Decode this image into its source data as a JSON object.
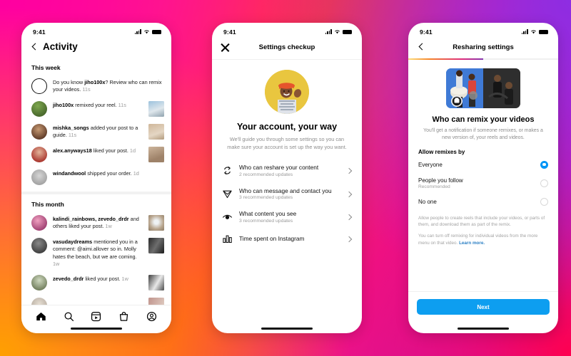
{
  "background": {
    "colors": [
      "#ff0f9c",
      "#ff3d2e",
      "#ffa000",
      "#8e2de2",
      "#ff0050"
    ]
  },
  "phone1": {
    "name": "activity-screen",
    "status": {
      "time": "9:41",
      "signal_icon": "signal-bars-icon",
      "wifi_icon": "wifi-icon",
      "battery_icon": "battery-icon"
    },
    "header": {
      "back_icon": "chevron-left-icon",
      "title": "Activity"
    },
    "sections": [
      {
        "label": "This week",
        "items": [
          {
            "avatar": "ring-icon",
            "avatar_style": "ring",
            "text_pre": "Do you know ",
            "bold": "jiho100x",
            "text_post": "? Review who can remix your videos. ",
            "time": "11s",
            "thumb": false
          },
          {
            "avatar": "avatar-jiho100x",
            "avatar_style": "photo-green",
            "text_pre": "",
            "bold": "jiho100x",
            "text_post": " remixed your reel. ",
            "time": "11s",
            "thumb": true,
            "thumb_style": "t1"
          },
          {
            "avatar": "avatar-mishka-songs",
            "avatar_style": "photo-brown",
            "text_pre": "",
            "bold": "mishka_songs",
            "text_post": " added your post to a guide. ",
            "time": "11s",
            "thumb": true,
            "thumb_style": "t2"
          },
          {
            "avatar": "avatar-alex-anyways18",
            "avatar_style": "photo-red",
            "text_pre": "",
            "bold": "alex.anyways18",
            "text_post": " liked your post. ",
            "time": "1d",
            "thumb": true,
            "thumb_style": "t3"
          },
          {
            "avatar": "avatar-windandwool",
            "avatar_style": "photo-grey",
            "text_pre": "",
            "bold": "windandwool",
            "text_post": " shipped your order. ",
            "time": "1d",
            "thumb": false
          }
        ]
      },
      {
        "label": "This month",
        "items": [
          {
            "avatar": "avatar-kalindi-rainbows",
            "avatar_style": "photo-pink",
            "text_pre": "",
            "bold": "kalindi_rainbows, zevedo_drdr",
            "text_post": " and others liked your post. ",
            "time": "1w",
            "thumb": true,
            "thumb_style": "t4"
          },
          {
            "avatar": "avatar-vasudaydreams",
            "avatar_style": "photo-dark",
            "text_pre": "",
            "bold": "vasudaydreams",
            "text_post": " mentioned you in a comment: @aimi.allover so in. Molly hates the beach, but we are coming. ",
            "time": "1w",
            "thumb": true,
            "thumb_style": "t5"
          },
          {
            "avatar": "avatar-zevedo-drdr",
            "avatar_style": "photo-green2",
            "text_pre": "",
            "bold": "zevedo_drdr",
            "text_post": " liked your post. ",
            "time": "1w",
            "thumb": true,
            "thumb_style": "t6"
          }
        ]
      }
    ],
    "tabs": [
      {
        "name": "tab-home",
        "icon": "home-icon"
      },
      {
        "name": "tab-search",
        "icon": "search-icon"
      },
      {
        "name": "tab-reels",
        "icon": "reels-icon"
      },
      {
        "name": "tab-shop",
        "icon": "shop-bag-icon"
      },
      {
        "name": "tab-profile",
        "icon": "profile-circle-icon"
      }
    ]
  },
  "phone2": {
    "name": "settings-checkup-screen",
    "status": {
      "time": "9:41"
    },
    "header": {
      "close_icon": "close-x-icon",
      "title": "Settings checkup"
    },
    "hero": {
      "avatar_name": "hero-avatar-waving-person"
    },
    "heading": "Your account, your way",
    "subheading": "We'll guide you through some settings so you can make sure your account is set up the way you want.",
    "menu": [
      {
        "icon": "reshare-loop-icon",
        "title": "Who can reshare your content",
        "subtitle": "2 recommended updates"
      },
      {
        "icon": "send-paper-plane-icon",
        "title": "Who can message and contact you",
        "subtitle": "3 recommended updates"
      },
      {
        "icon": "eye-icon",
        "title": "What content you see",
        "subtitle": "3 recommended updates"
      },
      {
        "icon": "bar-chart-icon",
        "title": "Time spent on Instagram",
        "subtitle": ""
      }
    ]
  },
  "phone3": {
    "name": "resharing-settings-screen",
    "status": {
      "time": "9:41"
    },
    "header": {
      "back_icon": "chevron-left-icon",
      "title": "Resharing settings"
    },
    "progress_percent": 50,
    "hero": {
      "image_name": "remix-video-preview-image",
      "badge_icon": "remix-badge-icon"
    },
    "heading": "Who can remix your videos",
    "subheading": "You'll get a notification if someone remixes, or makes a new version of, your reels and videos.",
    "group_label": "Allow remixes by",
    "options": [
      {
        "title": "Everyone",
        "subtitle": "",
        "selected": true
      },
      {
        "title": "People you follow",
        "subtitle": "Recommended",
        "selected": false
      },
      {
        "title": "No one",
        "subtitle": "",
        "selected": false
      }
    ],
    "legal_p1": "Allow people to create reels that include your videos, or parts of them, and download them as part of the remix.",
    "legal_p2": "You can turn off remixing for individual videos from the more menu on that video. ",
    "legal_link": "Learn more.",
    "primary_button": "Next",
    "accent_color": "#0d9ef0"
  }
}
